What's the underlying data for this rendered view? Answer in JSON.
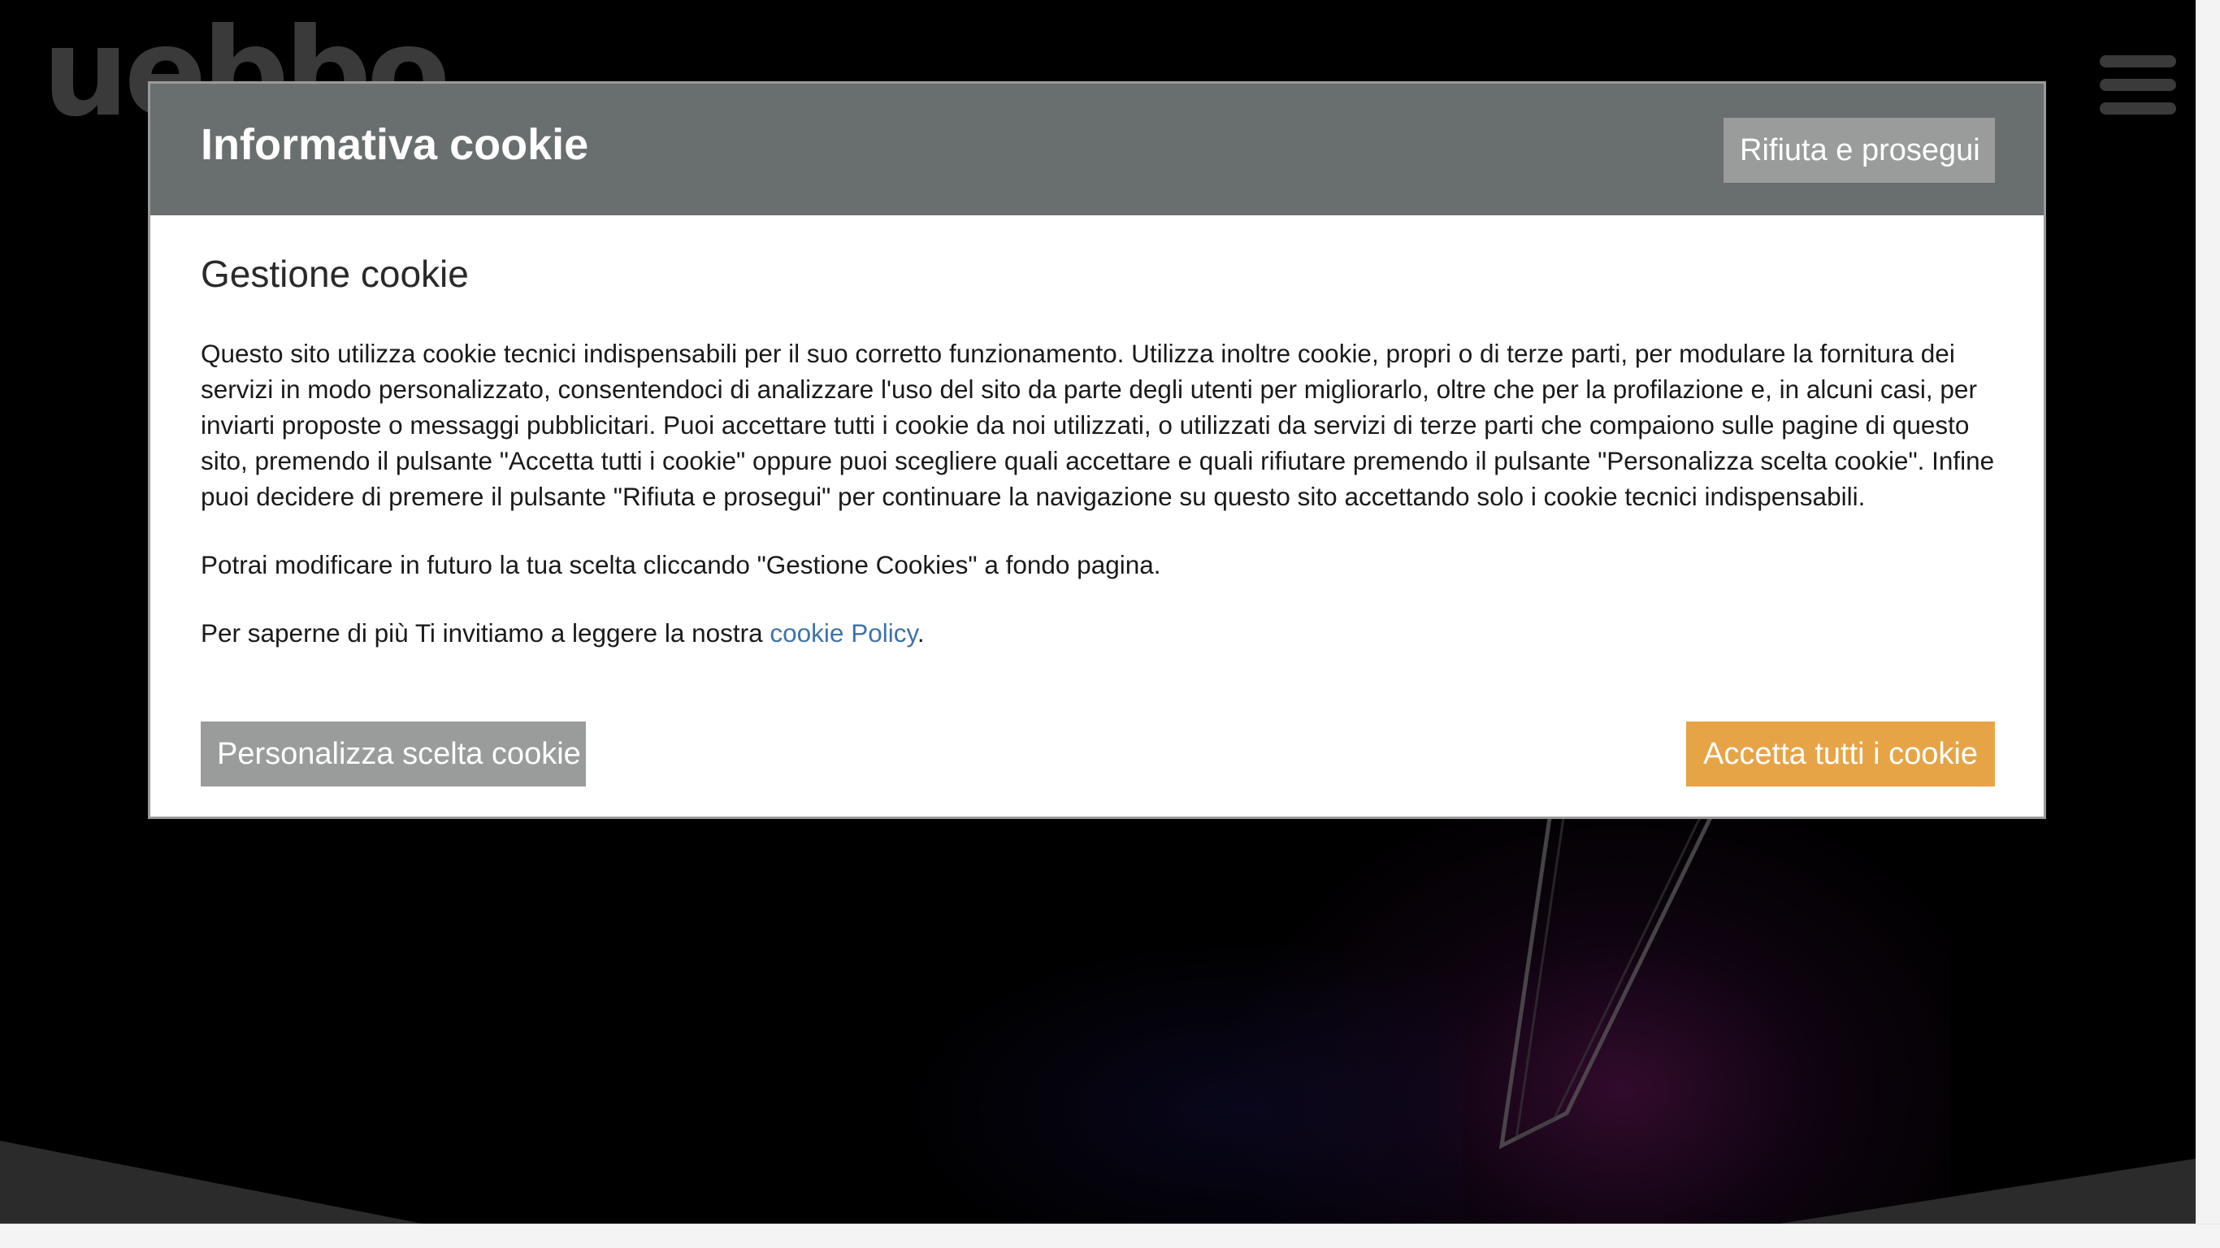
{
  "site": {
    "logo_text": "uebbo",
    "menu_icon": "hamburger-icon"
  },
  "cookie_modal": {
    "title": "Informativa cookie",
    "reject_label": "Rifiuta e prosegui",
    "subtitle": "Gestione cookie",
    "paragraph_1": "Questo sito utilizza cookie tecnici indispensabili per il suo corretto funzionamento. Utilizza inoltre cookie, propri o di terze parti, per modulare la fornitura dei servizi in modo personalizzato, consentendoci di analizzare l'uso del sito da parte degli utenti per migliorarlo, oltre che per la profilazione e, in alcuni casi, per inviarti proposte o messaggi pubblicitari. Puoi accettare tutti i cookie da noi utilizzati, o utilizzati da servizi di terze parti che compaiono sulle pagine di questo sito, premendo il pulsante \"Accetta tutti i cookie\" oppure puoi scegliere quali accettare e quali rifiutare premendo il pulsante \"Personalizza scelta cookie\". Infine puoi decidere di premere il pulsante \"Rifiuta e prosegui\" per continuare la navigazione su questo sito accettando solo i cookie tecnici indispensabili.",
    "paragraph_2": "Potrai modificare in futuro la tua scelta cliccando \"Gestione Cookies\" a fondo pagina.",
    "paragraph_3_prefix": "Per saperne di più Ti invitiamo a leggere la nostra ",
    "policy_link": "cookie Policy",
    "paragraph_3_suffix": ".",
    "customize_label": "Personalizza scelta cookie",
    "accept_label": "Accetta tutti i cookie",
    "colors": {
      "header_bg": "#696e6e",
      "secondary_button": "#9a9c9c",
      "accept_button": "#e7a446",
      "link": "#3f72a8"
    }
  }
}
